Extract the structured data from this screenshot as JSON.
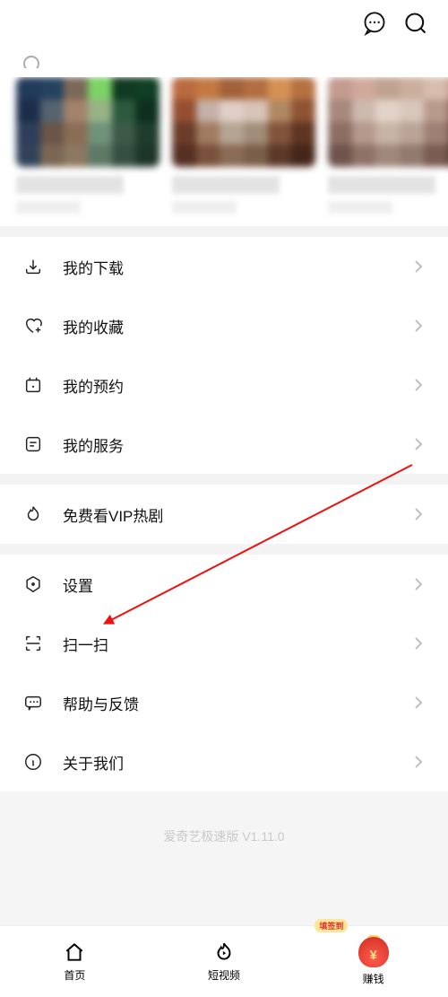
{
  "menu": {
    "group1": [
      {
        "label": "我的下载",
        "icon": "download"
      },
      {
        "label": "我的收藏",
        "icon": "heart-plus"
      },
      {
        "label": "我的预约",
        "icon": "calendar"
      },
      {
        "label": "我的服务",
        "icon": "list-box"
      }
    ],
    "group2": [
      {
        "label": "免费看VIP热剧",
        "icon": "flame"
      }
    ],
    "group3": [
      {
        "label": "设置",
        "icon": "hex-gear"
      },
      {
        "label": "扫一扫",
        "icon": "scan"
      },
      {
        "label": "帮助与反馈",
        "icon": "chat-dots"
      },
      {
        "label": "关于我们",
        "icon": "info"
      }
    ]
  },
  "footer": {
    "version": "爱奇艺极速版 V1.11.0"
  },
  "tabs": {
    "home": "首页",
    "short_video": "短视频",
    "earn": "赚钱",
    "earn_badge": "填签到"
  }
}
